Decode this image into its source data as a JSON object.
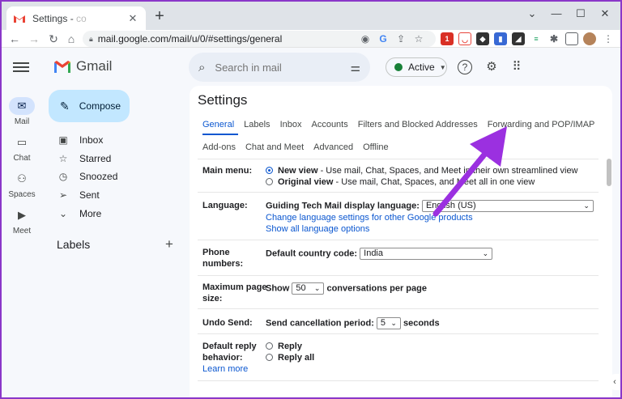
{
  "browser": {
    "tab_title": "Settings - ",
    "tab_title_faded": "co",
    "tab_close": "✕",
    "new_tab": "+",
    "url": "mail.google.com/mail/u/0/#settings/general",
    "window_buttons": [
      "⌄",
      "—",
      "☐",
      "✕"
    ]
  },
  "rail": {
    "items": [
      {
        "label": "Mail",
        "icon": "mail-icon",
        "active": true
      },
      {
        "label": "Chat",
        "icon": "chat-icon",
        "active": false
      },
      {
        "label": "Spaces",
        "icon": "spaces-icon",
        "active": false
      },
      {
        "label": "Meet",
        "icon": "meet-icon",
        "active": false
      }
    ]
  },
  "sidebar": {
    "logo_text": "Gmail",
    "compose_label": "Compose",
    "items": [
      {
        "label": "Inbox",
        "icon": "inbox-icon"
      },
      {
        "label": "Starred",
        "icon": "star-icon"
      },
      {
        "label": "Snoozed",
        "icon": "clock-icon"
      },
      {
        "label": "Sent",
        "icon": "send-icon"
      },
      {
        "label": "More",
        "icon": "chevron-down-icon"
      }
    ],
    "labels_heading": "Labels",
    "labels_add": "+"
  },
  "topbar": {
    "search_placeholder": "Search in mail",
    "status_label": "Active"
  },
  "settings": {
    "title": "Settings",
    "tabs_row1": [
      "General",
      "Labels",
      "Inbox",
      "Accounts",
      "Filters and Blocked Addresses",
      "Forwarding and POP/IMAP"
    ],
    "tabs_row2": [
      "Add-ons",
      "Chat and Meet",
      "Advanced",
      "Offline"
    ],
    "active_tab": "General",
    "main_menu": {
      "label": "Main menu:",
      "new_view_title": "New view",
      "new_view_desc": " - Use mail, Chat, Spaces, and Meet in their own streamlined view",
      "original_view_title": "Original view",
      "original_view_desc": " - Use mail, Chat, Spaces, and Meet all in one view"
    },
    "language": {
      "label": "Language:",
      "display_label": "Guiding Tech Mail display language:",
      "selected": "English (US)",
      "link_change": "Change language settings for other Google products",
      "link_show_all": "Show all language options"
    },
    "phone": {
      "label_line1": "Phone",
      "label_line2": "numbers:",
      "country_label": "Default country code:",
      "selected": "India"
    },
    "page_size": {
      "label_line1": "Maximum page",
      "label_line2": "size:",
      "show": "Show",
      "selected": "50",
      "suffix": "conversations per page"
    },
    "undo_send": {
      "label": "Undo Send:",
      "period_label": "Send cancellation period:",
      "selected": "5",
      "suffix": "seconds"
    },
    "reply": {
      "label_line1": "Default reply",
      "label_line2": "behavior:",
      "learn_more": "Learn more",
      "option_reply": "Reply",
      "option_reply_all": "Reply all"
    }
  },
  "colors": {
    "accent": "#0b57d0",
    "annotation_arrow": "#9b30e0",
    "frame_border": "#8a37c9"
  }
}
